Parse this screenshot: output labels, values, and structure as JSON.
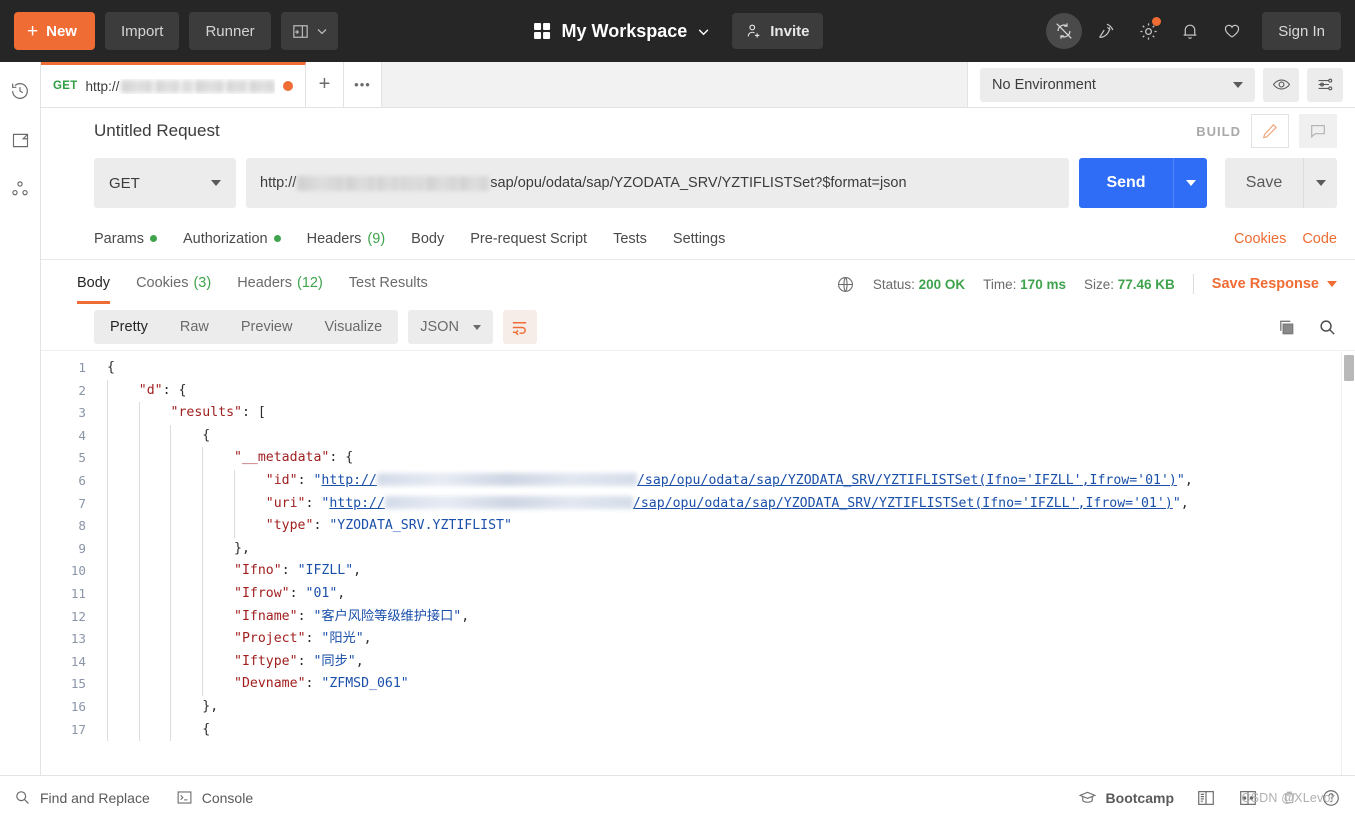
{
  "topbar": {
    "new_label": "New",
    "import_label": "Import",
    "runner_label": "Runner",
    "workspace_label": "My Workspace",
    "invite_label": "Invite",
    "signin_label": "Sign In",
    "accent_orange": "#ef6c34",
    "background": "#262626"
  },
  "sidebar": {
    "items": [
      {
        "name": "history",
        "label": "History"
      },
      {
        "name": "collections",
        "label": "Collections"
      },
      {
        "name": "apis",
        "label": "APIs"
      }
    ]
  },
  "tabs": {
    "active": {
      "method": "GET",
      "url_prefix": "http://",
      "url_blurred": true,
      "unsaved": true
    },
    "new_tab_label": "+",
    "more_label": "000"
  },
  "environment": {
    "selected": "No Environment"
  },
  "request": {
    "title": "Untitled Request",
    "build_label": "BUILD",
    "method": "GET",
    "url_prefix": "http://",
    "url_suffix": "sap/opu/odata/sap/YZODATA_SRV/YZTIFLISTSet?$format=json",
    "send_label": "Send",
    "save_label": "Save",
    "tabs": [
      {
        "label": "Params",
        "dot": true
      },
      {
        "label": "Authorization",
        "dot": true
      },
      {
        "label": "Headers",
        "count": "(9)"
      },
      {
        "label": "Body"
      },
      {
        "label": "Pre-request Script"
      },
      {
        "label": "Tests"
      },
      {
        "label": "Settings"
      }
    ],
    "cookies_link": "Cookies",
    "code_link": "Code"
  },
  "response": {
    "tabs": [
      {
        "label": "Body",
        "active": true
      },
      {
        "label": "Cookies",
        "count": "(3)"
      },
      {
        "label": "Headers",
        "count": "(12)"
      },
      {
        "label": "Test Results"
      }
    ],
    "status_label": "Status:",
    "status_value": "200 OK",
    "time_label": "Time:",
    "time_value": "170 ms",
    "size_label": "Size:",
    "size_value": "77.46 KB",
    "save_response_label": "Save Response",
    "view_modes": [
      {
        "label": "Pretty",
        "active": true
      },
      {
        "label": "Raw"
      },
      {
        "label": "Preview"
      },
      {
        "label": "Visualize"
      }
    ],
    "format": "JSON",
    "body_lines": [
      {
        "n": "1",
        "indent": 0,
        "tokens": [
          {
            "t": "p",
            "v": "{"
          }
        ]
      },
      {
        "n": "2",
        "indent": 1,
        "tokens": [
          {
            "t": "k",
            "v": "\"d\""
          },
          {
            "t": "p",
            "v": ": {"
          }
        ]
      },
      {
        "n": "3",
        "indent": 2,
        "tokens": [
          {
            "t": "k",
            "v": "\"results\""
          },
          {
            "t": "p",
            "v": ": ["
          }
        ]
      },
      {
        "n": "4",
        "indent": 3,
        "tokens": [
          {
            "t": "p",
            "v": "{"
          }
        ]
      },
      {
        "n": "5",
        "indent": 4,
        "tokens": [
          {
            "t": "k",
            "v": "\"__metadata\""
          },
          {
            "t": "p",
            "v": ": {"
          }
        ]
      },
      {
        "n": "6",
        "indent": 5,
        "tokens": [
          {
            "t": "k",
            "v": "\"id\""
          },
          {
            "t": "p",
            "v": ": "
          },
          {
            "t": "s",
            "v": "\""
          },
          {
            "t": "lnk",
            "v": "http://"
          },
          {
            "t": "blur",
            "v": "260"
          },
          {
            "t": "lnk",
            "v": "/sap/opu/odata/sap/YZODATA_SRV/YZTIFLISTSet(Ifno='IFZLL',Ifrow='01')"
          },
          {
            "t": "s",
            "v": "\""
          },
          {
            "t": "p",
            "v": ","
          }
        ]
      },
      {
        "n": "7",
        "indent": 5,
        "tokens": [
          {
            "t": "k",
            "v": "\"uri\""
          },
          {
            "t": "p",
            "v": ": "
          },
          {
            "t": "s",
            "v": "\""
          },
          {
            "t": "lnk",
            "v": "http://"
          },
          {
            "t": "blur",
            "v": "248"
          },
          {
            "t": "lnk",
            "v": "/sap/opu/odata/sap/YZODATA_SRV/YZTIFLISTSet(Ifno='IFZLL',Ifrow='01')"
          },
          {
            "t": "s",
            "v": "\""
          },
          {
            "t": "p",
            "v": ","
          }
        ]
      },
      {
        "n": "8",
        "indent": 5,
        "tokens": [
          {
            "t": "k",
            "v": "\"type\""
          },
          {
            "t": "p",
            "v": ": "
          },
          {
            "t": "s",
            "v": "\"YZODATA_SRV.YZTIFLIST\""
          }
        ]
      },
      {
        "n": "9",
        "indent": 4,
        "tokens": [
          {
            "t": "p",
            "v": "},"
          }
        ]
      },
      {
        "n": "10",
        "indent": 4,
        "tokens": [
          {
            "t": "k",
            "v": "\"Ifno\""
          },
          {
            "t": "p",
            "v": ": "
          },
          {
            "t": "s",
            "v": "\"IFZLL\""
          },
          {
            "t": "p",
            "v": ","
          }
        ]
      },
      {
        "n": "11",
        "indent": 4,
        "tokens": [
          {
            "t": "k",
            "v": "\"Ifrow\""
          },
          {
            "t": "p",
            "v": ": "
          },
          {
            "t": "s",
            "v": "\"01\""
          },
          {
            "t": "p",
            "v": ","
          }
        ]
      },
      {
        "n": "12",
        "indent": 4,
        "tokens": [
          {
            "t": "k",
            "v": "\"Ifname\""
          },
          {
            "t": "p",
            "v": ": "
          },
          {
            "t": "s",
            "v": "\"客户风险等级维护接口\""
          },
          {
            "t": "p",
            "v": ","
          }
        ]
      },
      {
        "n": "13",
        "indent": 4,
        "tokens": [
          {
            "t": "k",
            "v": "\"Project\""
          },
          {
            "t": "p",
            "v": ": "
          },
          {
            "t": "s",
            "v": "\"阳光\""
          },
          {
            "t": "p",
            "v": ","
          }
        ]
      },
      {
        "n": "14",
        "indent": 4,
        "tokens": [
          {
            "t": "k",
            "v": "\"Iftype\""
          },
          {
            "t": "p",
            "v": ": "
          },
          {
            "t": "s",
            "v": "\"同步\""
          },
          {
            "t": "p",
            "v": ","
          }
        ]
      },
      {
        "n": "15",
        "indent": 4,
        "tokens": [
          {
            "t": "k",
            "v": "\"Devname\""
          },
          {
            "t": "p",
            "v": ": "
          },
          {
            "t": "s",
            "v": "\"ZFMSD_061\""
          }
        ]
      },
      {
        "n": "16",
        "indent": 3,
        "tokens": [
          {
            "t": "p",
            "v": "},"
          }
        ]
      },
      {
        "n": "17",
        "indent": 3,
        "tokens": [
          {
            "t": "p",
            "v": "{"
          }
        ]
      }
    ]
  },
  "footer": {
    "find_replace_label": "Find and Replace",
    "console_label": "Console",
    "bootcamp_label": "Bootcamp",
    "watermark": "CSDN @XLevor"
  }
}
